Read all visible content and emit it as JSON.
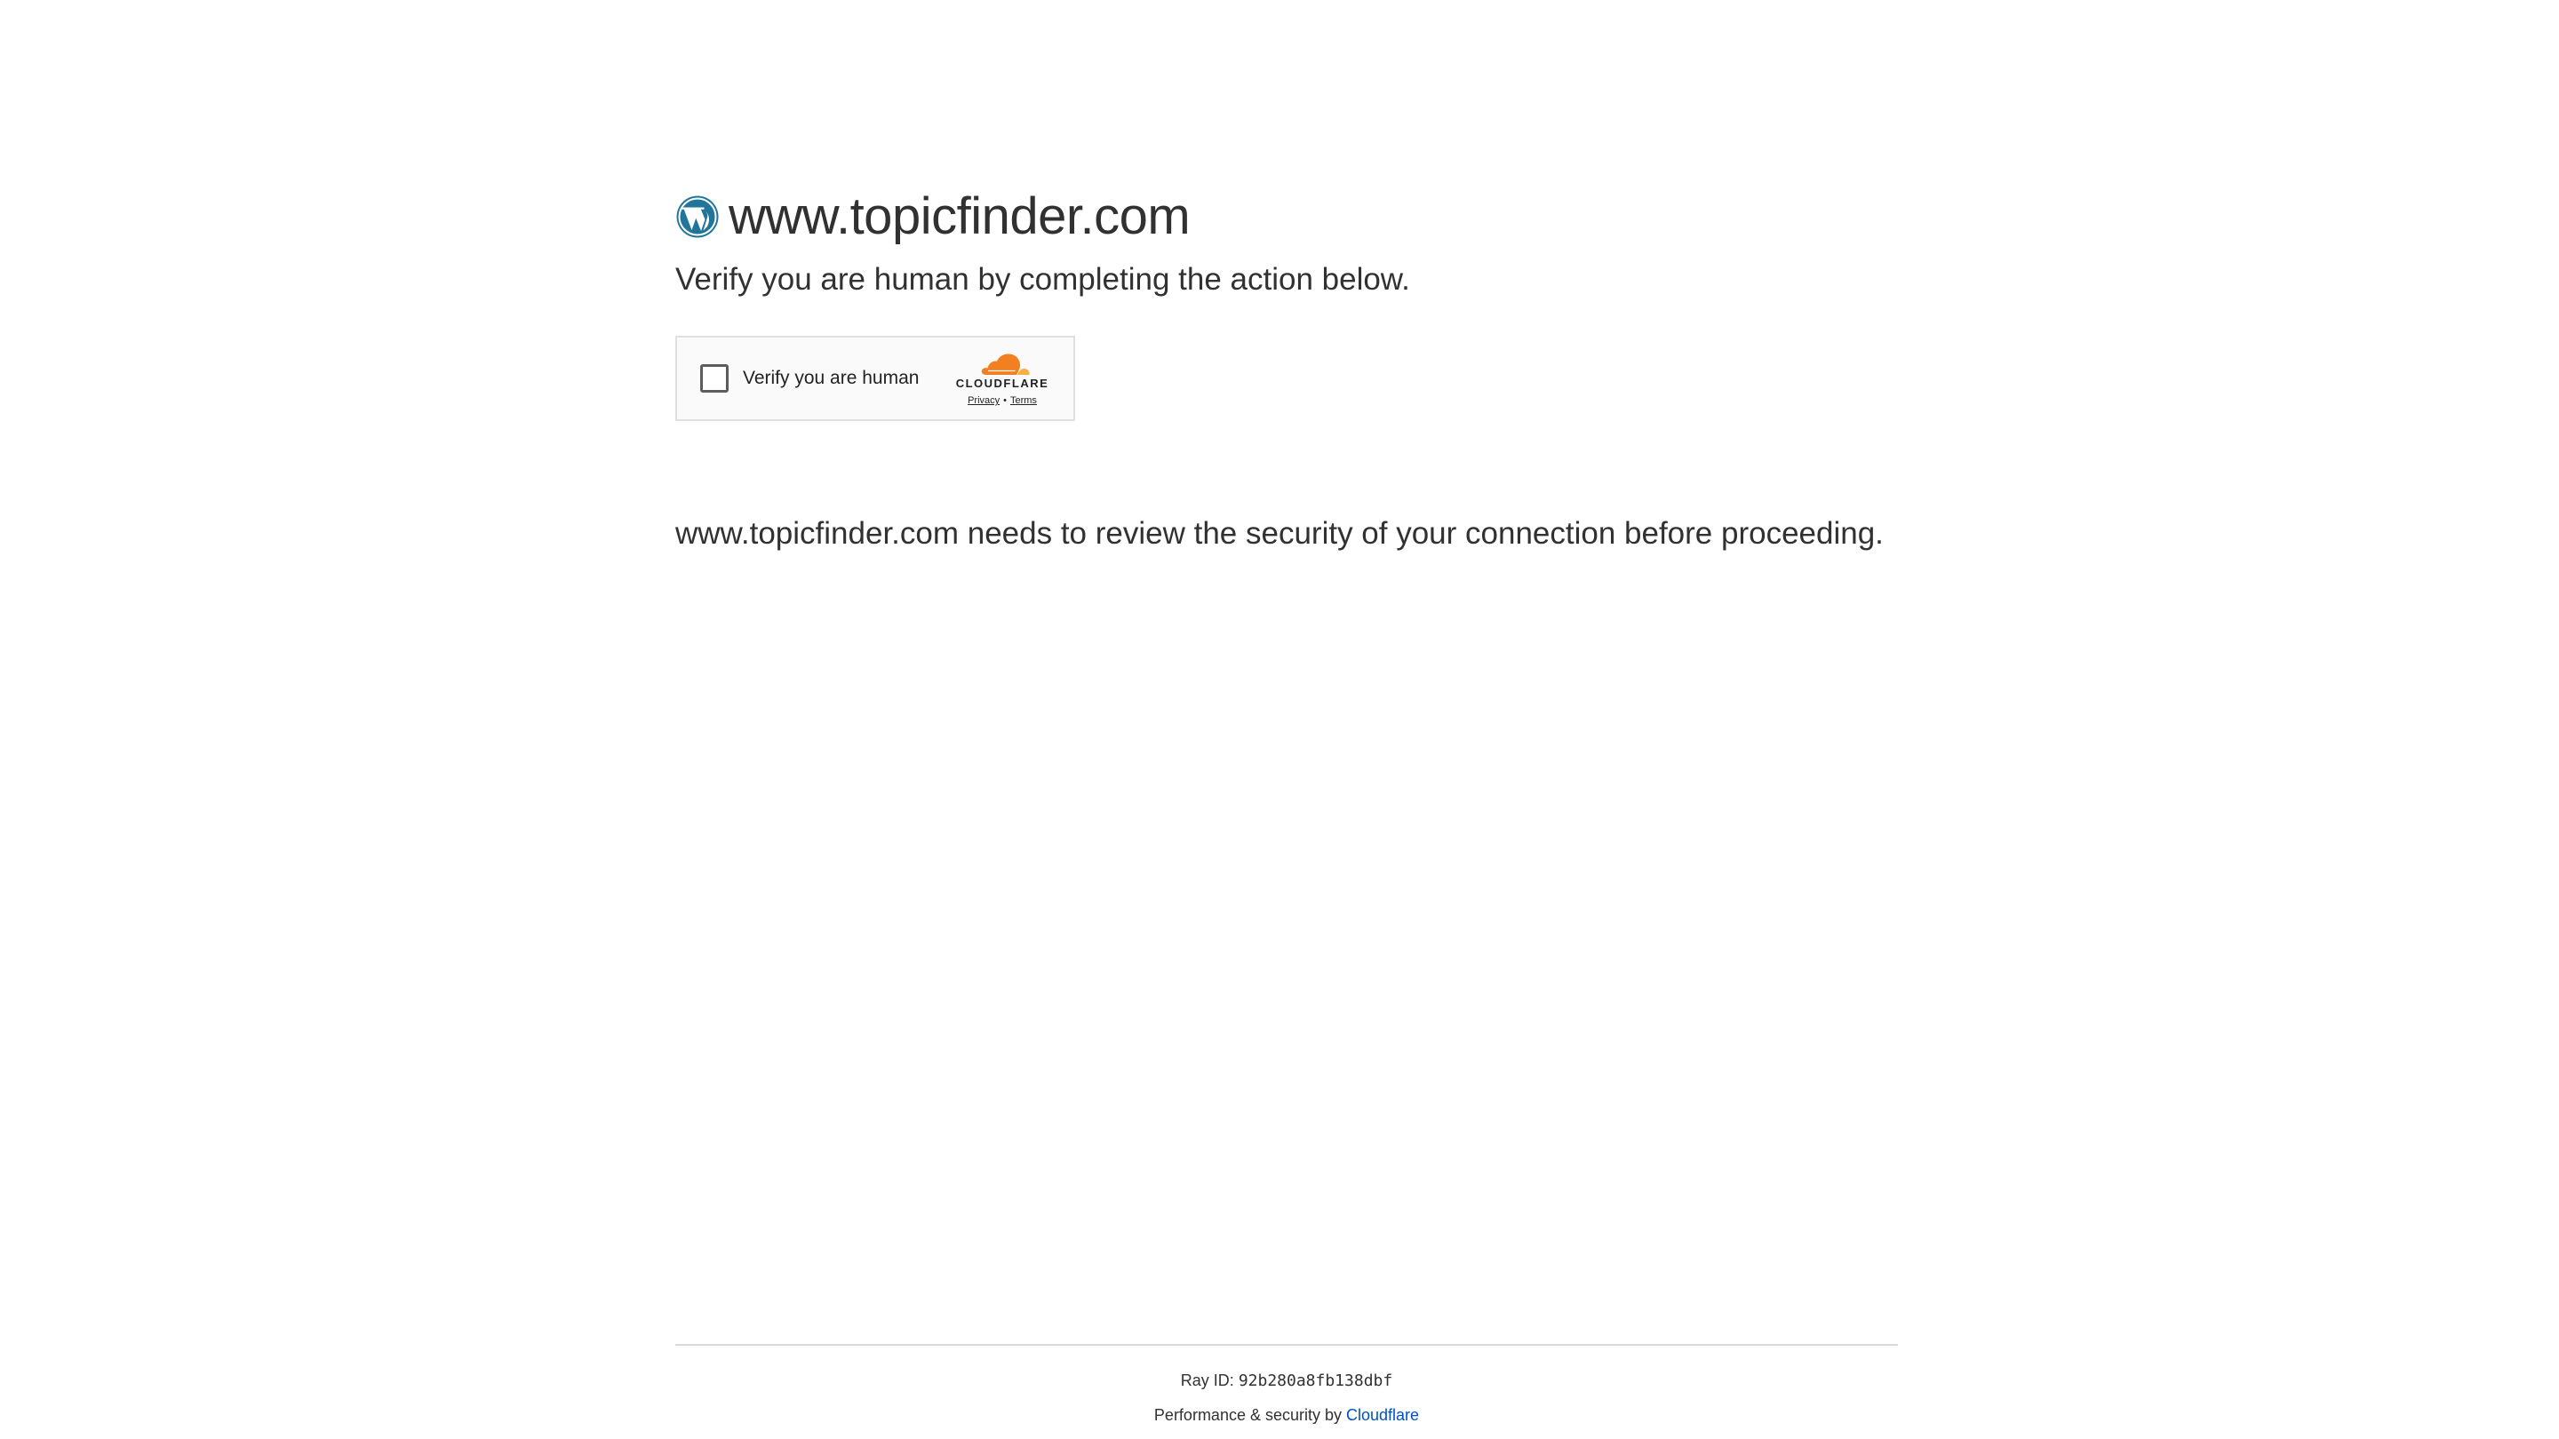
{
  "header": {
    "site_title": "www.topicfinder.com",
    "logo_icon": "wordpress-logo-icon",
    "subtitle": "Verify you are human by completing the action below."
  },
  "challenge_widget": {
    "checkbox_label": "Verify you are human",
    "checked": false,
    "brand_word": "CLOUDFLARE",
    "brand_icon": "cloudflare-cloud-icon",
    "privacy_link": "Privacy",
    "separator": "•",
    "terms_link": "Terms"
  },
  "notice": {
    "text": "www.topicfinder.com needs to review the security of your connection before proceeding."
  },
  "footer": {
    "ray_label": "Ray ID: ",
    "ray_id": "92b280a8fb138dbf",
    "perf_prefix": "Performance & security by ",
    "perf_link": "Cloudflare"
  },
  "colors": {
    "text": "#313131",
    "link": "#0051c3",
    "wordpress_blue": "#21759b",
    "cloudflare_orange": "#f38020",
    "cloudflare_orange_light": "#faae40"
  }
}
